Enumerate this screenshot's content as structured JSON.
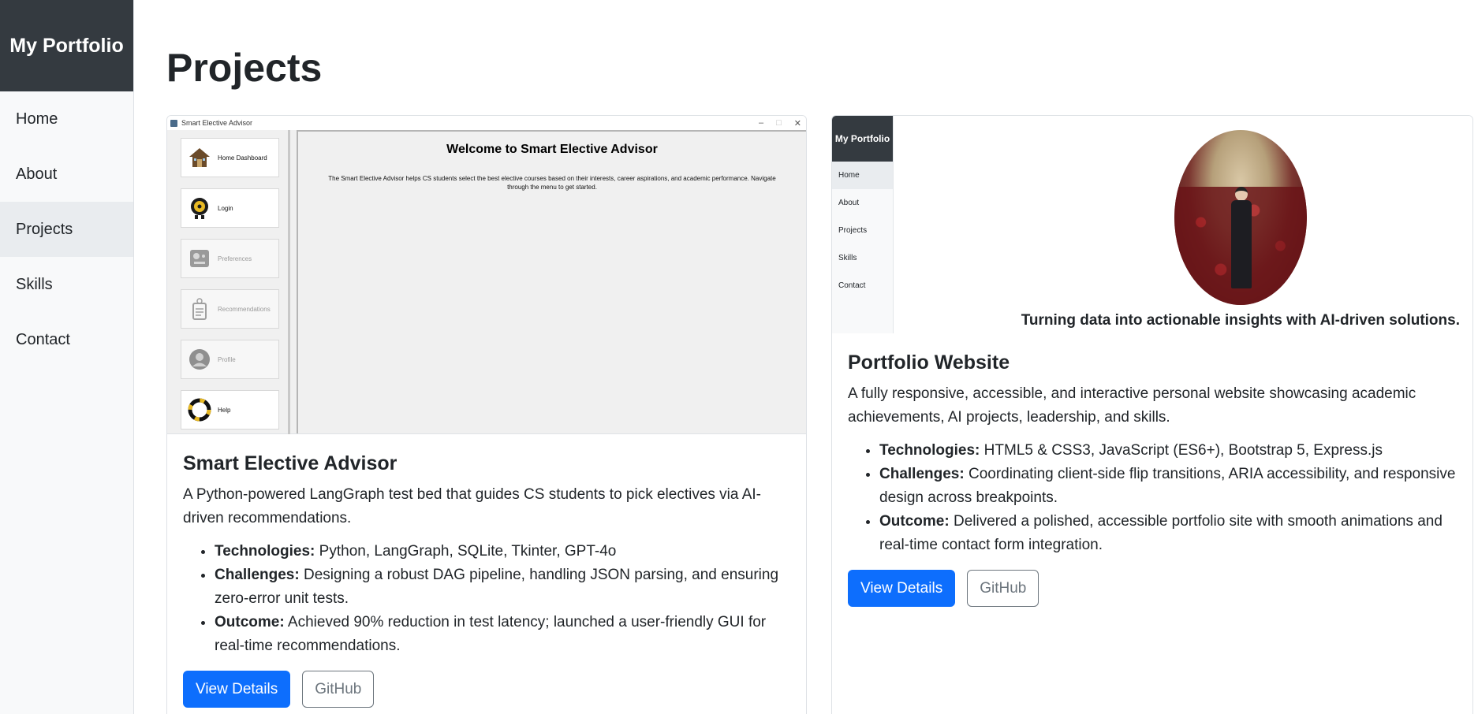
{
  "sidebar": {
    "brand": "My Portfolio",
    "items": [
      {
        "label": "Home"
      },
      {
        "label": "About"
      },
      {
        "label": "Projects",
        "active": true
      },
      {
        "label": "Skills"
      },
      {
        "label": "Contact"
      }
    ]
  },
  "page": {
    "title": "Projects"
  },
  "projects": [
    {
      "title": "Smart Elective Advisor",
      "description": "A Python-powered LangGraph test bed that guides CS students to pick electives via AI-driven recommendations.",
      "details": [
        {
          "label": "Technologies:",
          "text": "Python, LangGraph, SQLite, Tkinter, GPT-4o"
        },
        {
          "label": "Challenges:",
          "text": "Designing a robust DAG pipeline, handling JSON parsing, and ensuring zero-error unit tests."
        },
        {
          "label": "Outcome:",
          "text": "Achieved 90% reduction in test latency; launched a user-friendly GUI for real-time recommendations."
        }
      ],
      "buttons": {
        "primary": "View Details",
        "secondary": "GitHub"
      },
      "screenshot": {
        "window_title": "Smart Elective Advisor",
        "heading": "Welcome to Smart Elective Advisor",
        "description": "The Smart Elective Advisor helps CS students select the best elective courses based on their interests, career aspirations, and academic performance. Navigate through the menu to get started.",
        "menu": [
          {
            "label": "Home Dashboard",
            "icon": "house-icon"
          },
          {
            "label": "Login",
            "icon": "lock-icon"
          },
          {
            "label": "Preferences",
            "icon": "settings-icon"
          },
          {
            "label": "Recommendations",
            "icon": "clipboard-icon"
          },
          {
            "label": "Profile",
            "icon": "user-icon"
          },
          {
            "label": "Help",
            "icon": "lifebuoy-icon"
          }
        ]
      }
    },
    {
      "title": "Portfolio Website",
      "description": "A fully responsive, accessible, and interactive personal website showcasing academic achievements, AI projects, leadership, and skills.",
      "details": [
        {
          "label": "Technologies:",
          "text": "HTML5 & CSS3, JavaScript (ES6+), Bootstrap 5, Express.js"
        },
        {
          "label": "Challenges:",
          "text": "Coordinating client-side flip transitions, ARIA accessibility, and responsive design across breakpoints."
        },
        {
          "label": "Outcome:",
          "text": "Delivered a polished, accessible portfolio site with smooth animations and real-time contact form integration."
        }
      ],
      "buttons": {
        "primary": "View Details",
        "secondary": "GitHub"
      },
      "screenshot": {
        "brand": "My Portfolio",
        "nav": [
          "Home",
          "About",
          "Projects",
          "Skills",
          "Contact"
        ],
        "tagline": "Turning data into actionable insights with AI-driven solutions."
      }
    }
  ],
  "colors": {
    "primary": "#0d6efd",
    "sidebar_brand_bg": "#343a40",
    "sidebar_bg": "#f8f9fa",
    "active_bg": "#e9ecef"
  }
}
